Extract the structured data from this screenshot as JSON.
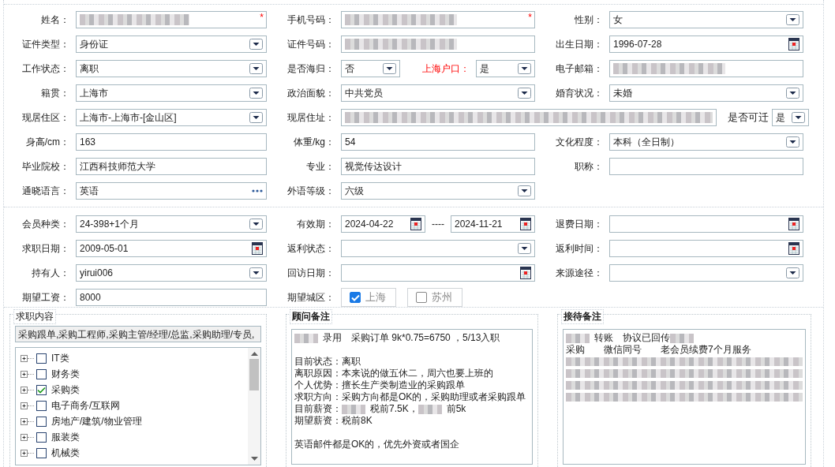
{
  "sections": [
    {
      "rows": [
        [
          {
            "label": "姓名：",
            "kind": "text",
            "redacted": true,
            "required_mark": "*"
          },
          {
            "label": "手机号码：",
            "kind": "text",
            "redacted": true,
            "required_mark": "*"
          },
          {
            "label": "性别：",
            "kind": "select",
            "value": "女"
          }
        ],
        [
          {
            "label": "证件类型：",
            "kind": "select",
            "value": "身份证"
          },
          {
            "label": "证件号码：",
            "kind": "text",
            "redacted": true
          },
          {
            "label": "出生日期：",
            "kind": "date",
            "value": "1996-07-28"
          }
        ],
        [
          {
            "label": "工作状态：",
            "kind": "select",
            "value": "离职"
          },
          {
            "label": "是否海归：",
            "kind": "select",
            "value": "否",
            "extra": {
              "label": "上海户口：",
              "alert": true,
              "kind": "select",
              "value": "是"
            }
          },
          {
            "label": "电子邮箱：",
            "kind": "text",
            "redacted": true
          }
        ],
        [
          {
            "label": "籍贯：",
            "kind": "select",
            "value": "上海市"
          },
          {
            "label": "政治面貌：",
            "kind": "select",
            "value": "中共党员"
          },
          {
            "label": "婚育状况：",
            "kind": "select",
            "value": "未婚"
          }
        ],
        [
          {
            "label": "现居住区：",
            "kind": "select",
            "value": "上海市-上海市-[金山区]"
          },
          {
            "label": "现居住址：",
            "kind": "text",
            "redacted": true,
            "wide": true,
            "extra": {
              "label": "是否可迁",
              "alert": false,
              "kind": "select",
              "value": "是"
            }
          }
        ],
        [
          {
            "label": "身高/cm：",
            "kind": "text",
            "value": "163"
          },
          {
            "label": "体重/kg：",
            "kind": "text",
            "value": "54"
          },
          {
            "label": "文化程度：",
            "kind": "select",
            "value": "本科（全日制）"
          }
        ],
        [
          {
            "label": "毕业院校：",
            "kind": "text",
            "value": "江西科技师范大学"
          },
          {
            "label": "专业：",
            "kind": "text",
            "value": "视觉传达设计"
          },
          {
            "label": "职称：",
            "kind": "text"
          }
        ],
        [
          {
            "label": "通晓语言：",
            "kind": "lookup",
            "value": "英语"
          },
          {
            "label": "外语等级：",
            "kind": "select",
            "value": "六级"
          },
          null
        ]
      ]
    },
    {
      "rows": [
        [
          {
            "label": "会员种类：",
            "kind": "select",
            "value": "24-398+1个月"
          },
          {
            "label": "有效期：",
            "kind": "date",
            "value": "2024-04-22",
            "extra": {
              "separator": "----",
              "kind": "date",
              "value": "2024-11-21"
            }
          },
          {
            "label": "退费日期：",
            "kind": "date"
          }
        ],
        [
          {
            "label": "求职日期：",
            "kind": "date",
            "value": "2009-05-01"
          },
          {
            "label": "返利状态：",
            "kind": "select"
          },
          {
            "label": "返利时间：",
            "kind": "date"
          }
        ],
        [
          {
            "label": "持有人：",
            "kind": "select",
            "value": "yirui006"
          },
          {
            "label": "回访日期：",
            "kind": "date"
          },
          {
            "label": "来源途径：",
            "kind": "select"
          }
        ],
        [
          {
            "label": "期望工资：",
            "kind": "text",
            "value": "8000"
          },
          {
            "label": "期望城区：",
            "kind": "checkgroup",
            "options": [
              {
                "label": "上海",
                "checked": true
              },
              {
                "label": "苏州",
                "checked": false
              }
            ]
          },
          null
        ]
      ]
    }
  ],
  "panels": [
    {
      "kind": "tree",
      "title": "求职内容",
      "summary": "采购跟单,采购工程师,采购主管/经理/总监,采购助理/专员,",
      "items": [
        {
          "label": "IT类",
          "checked": false,
          "expanded": false
        },
        {
          "label": "财务类",
          "checked": false,
          "expanded": false
        },
        {
          "label": "采购类",
          "checked": true,
          "expanded": false
        },
        {
          "label": "电子商务/互联网",
          "checked": false,
          "expanded": false
        },
        {
          "label": "房地产/建筑/物业管理",
          "checked": false,
          "expanded": false
        },
        {
          "label": "服装类",
          "checked": false,
          "expanded": false
        },
        {
          "label": "机械类",
          "checked": false,
          "expanded": false
        }
      ]
    },
    {
      "kind": "notes",
      "title": "顾问备注",
      "lines": [
        {
          "kind": "text",
          "parts": [
            {
              "kind": "redacted"
            },
            {
              "kind": "text",
              "text": "录用　采购订单 9k*0.75=6750 ，5/13入职"
            }
          ]
        },
        {
          "kind": "blank"
        },
        {
          "kind": "text",
          "parts": [
            {
              "kind": "text",
              "text": "目前状态：离职"
            }
          ]
        },
        {
          "kind": "text",
          "parts": [
            {
              "kind": "text",
              "text": "离职原因：本来说的做五休二，周六也要上班的"
            }
          ]
        },
        {
          "kind": "text",
          "parts": [
            {
              "kind": "text",
              "text": "个人优势：擅长生产类制造业的采购跟单"
            }
          ]
        },
        {
          "kind": "text",
          "parts": [
            {
              "kind": "text",
              "text": "求职方向：采购方向都是OK的，采购助理或者采购跟单"
            }
          ]
        },
        {
          "kind": "text",
          "parts": [
            {
              "kind": "text",
              "text": "目前薪资："
            },
            {
              "kind": "redacted"
            },
            {
              "kind": "text",
              "text": "税前7.5K，"
            },
            {
              "kind": "redacted"
            },
            {
              "kind": "text",
              "text": "前5k"
            }
          ]
        },
        {
          "kind": "text",
          "parts": [
            {
              "kind": "text",
              "text": "期望薪资：税前8K"
            }
          ]
        },
        {
          "kind": "blank"
        },
        {
          "kind": "text",
          "parts": [
            {
              "kind": "text",
              "text": "英语邮件都是OK的，优先外资或者国企"
            }
          ]
        }
      ]
    },
    {
      "kind": "notes",
      "title": "接待备注",
      "lines": [
        {
          "kind": "text",
          "parts": [
            {
              "kind": "redacted"
            },
            {
              "kind": "text",
              "text": "转账　协议已回传"
            },
            {
              "kind": "redacted"
            }
          ]
        },
        {
          "kind": "text",
          "parts": [
            {
              "kind": "text",
              "text": "采购　　微信同号　　老会员续费7个月服务"
            }
          ]
        },
        {
          "kind": "redacted"
        },
        {
          "kind": "redacted"
        },
        {
          "kind": "redacted"
        },
        {
          "kind": "redacted"
        }
      ]
    }
  ]
}
